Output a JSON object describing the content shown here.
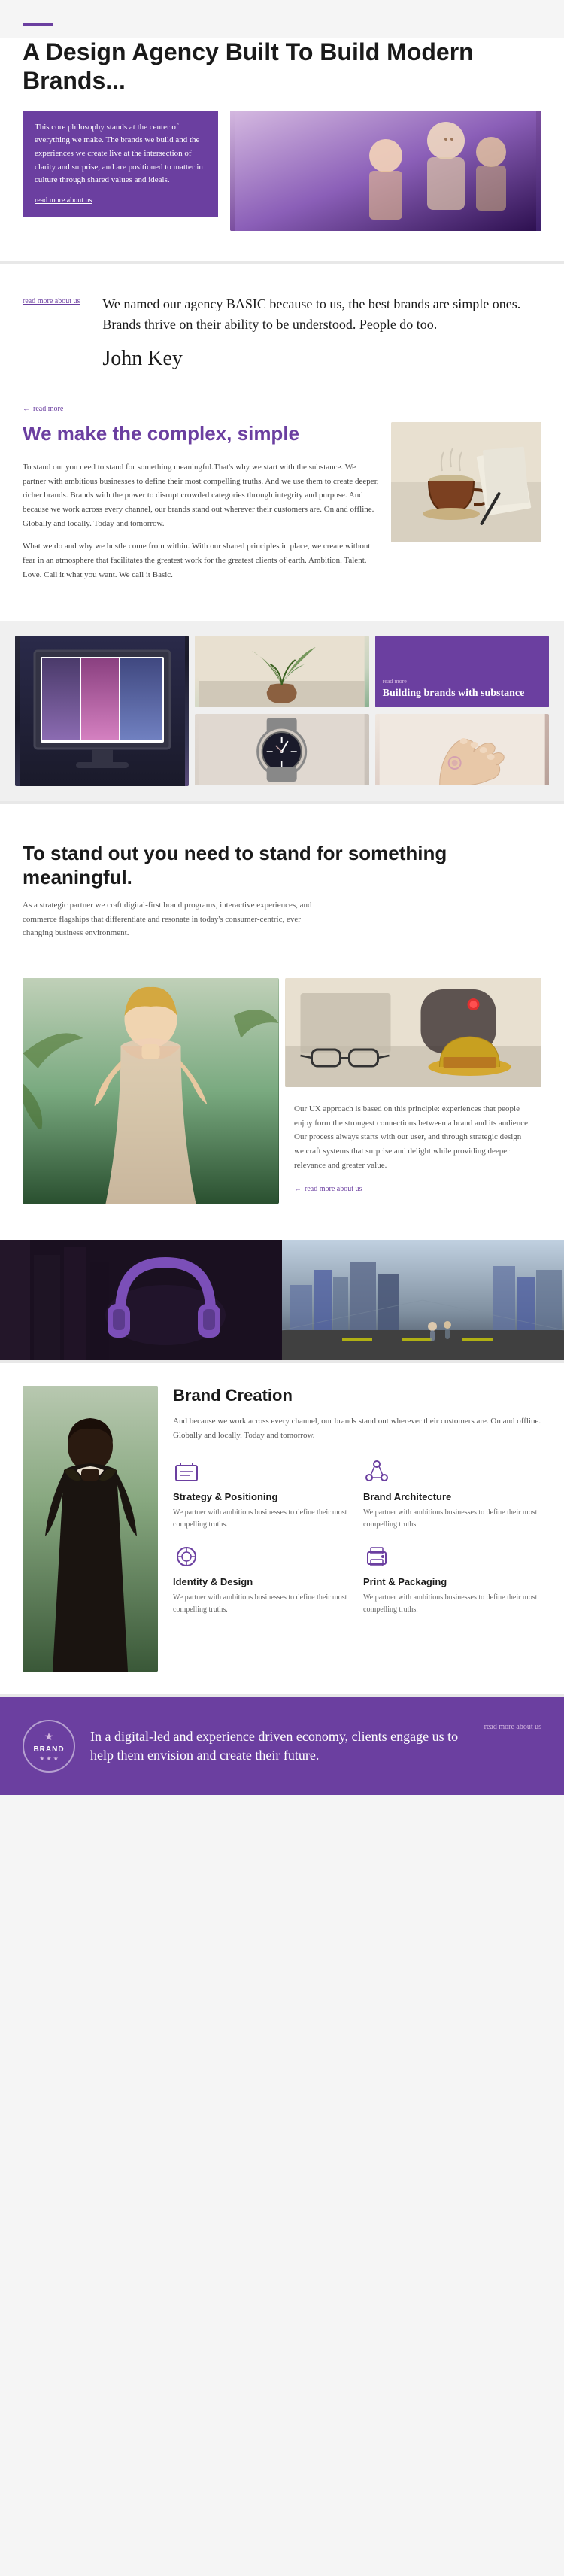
{
  "hero": {
    "accent_line": true,
    "title": "A Design Agency Built To Build Modern Brands...",
    "description": "This core philosophy stands at the center of everything we make. The brands we build and the experiences we create live at the intersection of clarity and surprise, and are positioned to matter in culture through shared values and ideals.",
    "read_more": "read more about us"
  },
  "agency": {
    "read_more_label": "read more about us",
    "statement": "We named our agency BASIC because to us, the best brands are simple ones. Brands thrive on their ability to be understood. People do too.",
    "signature": "John Key"
  },
  "complex": {
    "read_more_label": "read more",
    "title": "We make the complex, simple",
    "body1": "To stand out you need to stand for something meaningful.That's why we start with the substance. We partner with ambitious businesses to define their most compelling truths. And we use them to create deeper, richer brands. Brands with the power to disrupt crowded categories through integrity and purpose. And because we work across every channel, our brands stand out wherever their customers are. On and offline. Globally and locally. Today and tomorrow.",
    "body2": "What we do and why we hustle come from within. With our shared principles in place, we create without fear in an atmosphere that facilitates the greatest work for the greatest clients of earth. Ambition. Talent. Love. Call it what you want. We call it Basic."
  },
  "building_brands": {
    "read_more_label": "read more",
    "title": "Building brands with substance"
  },
  "standout": {
    "title": "To stand out you need to stand for something meaningful.",
    "description": "As a strategic partner we craft digital-first brand programs, interactive experiences, and commerce flagships that differentiate and resonate in today's consumer-centric, ever changing business environment."
  },
  "ux": {
    "description": "Our UX approach is based on this principle: experiences that people enjoy form the strongest connections between a brand and its audience. Our process always starts with our user, and through strategic design we craft systems that surprise and delight while providing deeper relevance and greater value.",
    "read_more": "read more about us"
  },
  "brand_creation": {
    "title": "Brand Creation",
    "description": "And because we work across every channel, our brands stand out wherever their customers are. On and offline. Globally and locally. Today and tomorrow.",
    "services": [
      {
        "icon": "strategy-icon",
        "title": "Strategy & Positioning",
        "text": "We partner with ambitious businesses to define their most compelling truths."
      },
      {
        "icon": "architecture-icon",
        "title": "Brand Architecture",
        "text": "We partner with ambitious businesses to define their most compelling truths."
      },
      {
        "icon": "identity-icon",
        "title": "Identity & Design",
        "text": "We partner with ambitious businesses to define their most compelling truths."
      },
      {
        "icon": "print-icon",
        "title": "Print & Packaging",
        "text": "We partner with ambitious businesses to define their most compelling truths."
      }
    ]
  },
  "footer": {
    "brand_name": "BRAND",
    "tagline": "In a digital-led and experience driven economy, clients engage us to help them envision and create their future.",
    "read_more": "read more about us"
  }
}
